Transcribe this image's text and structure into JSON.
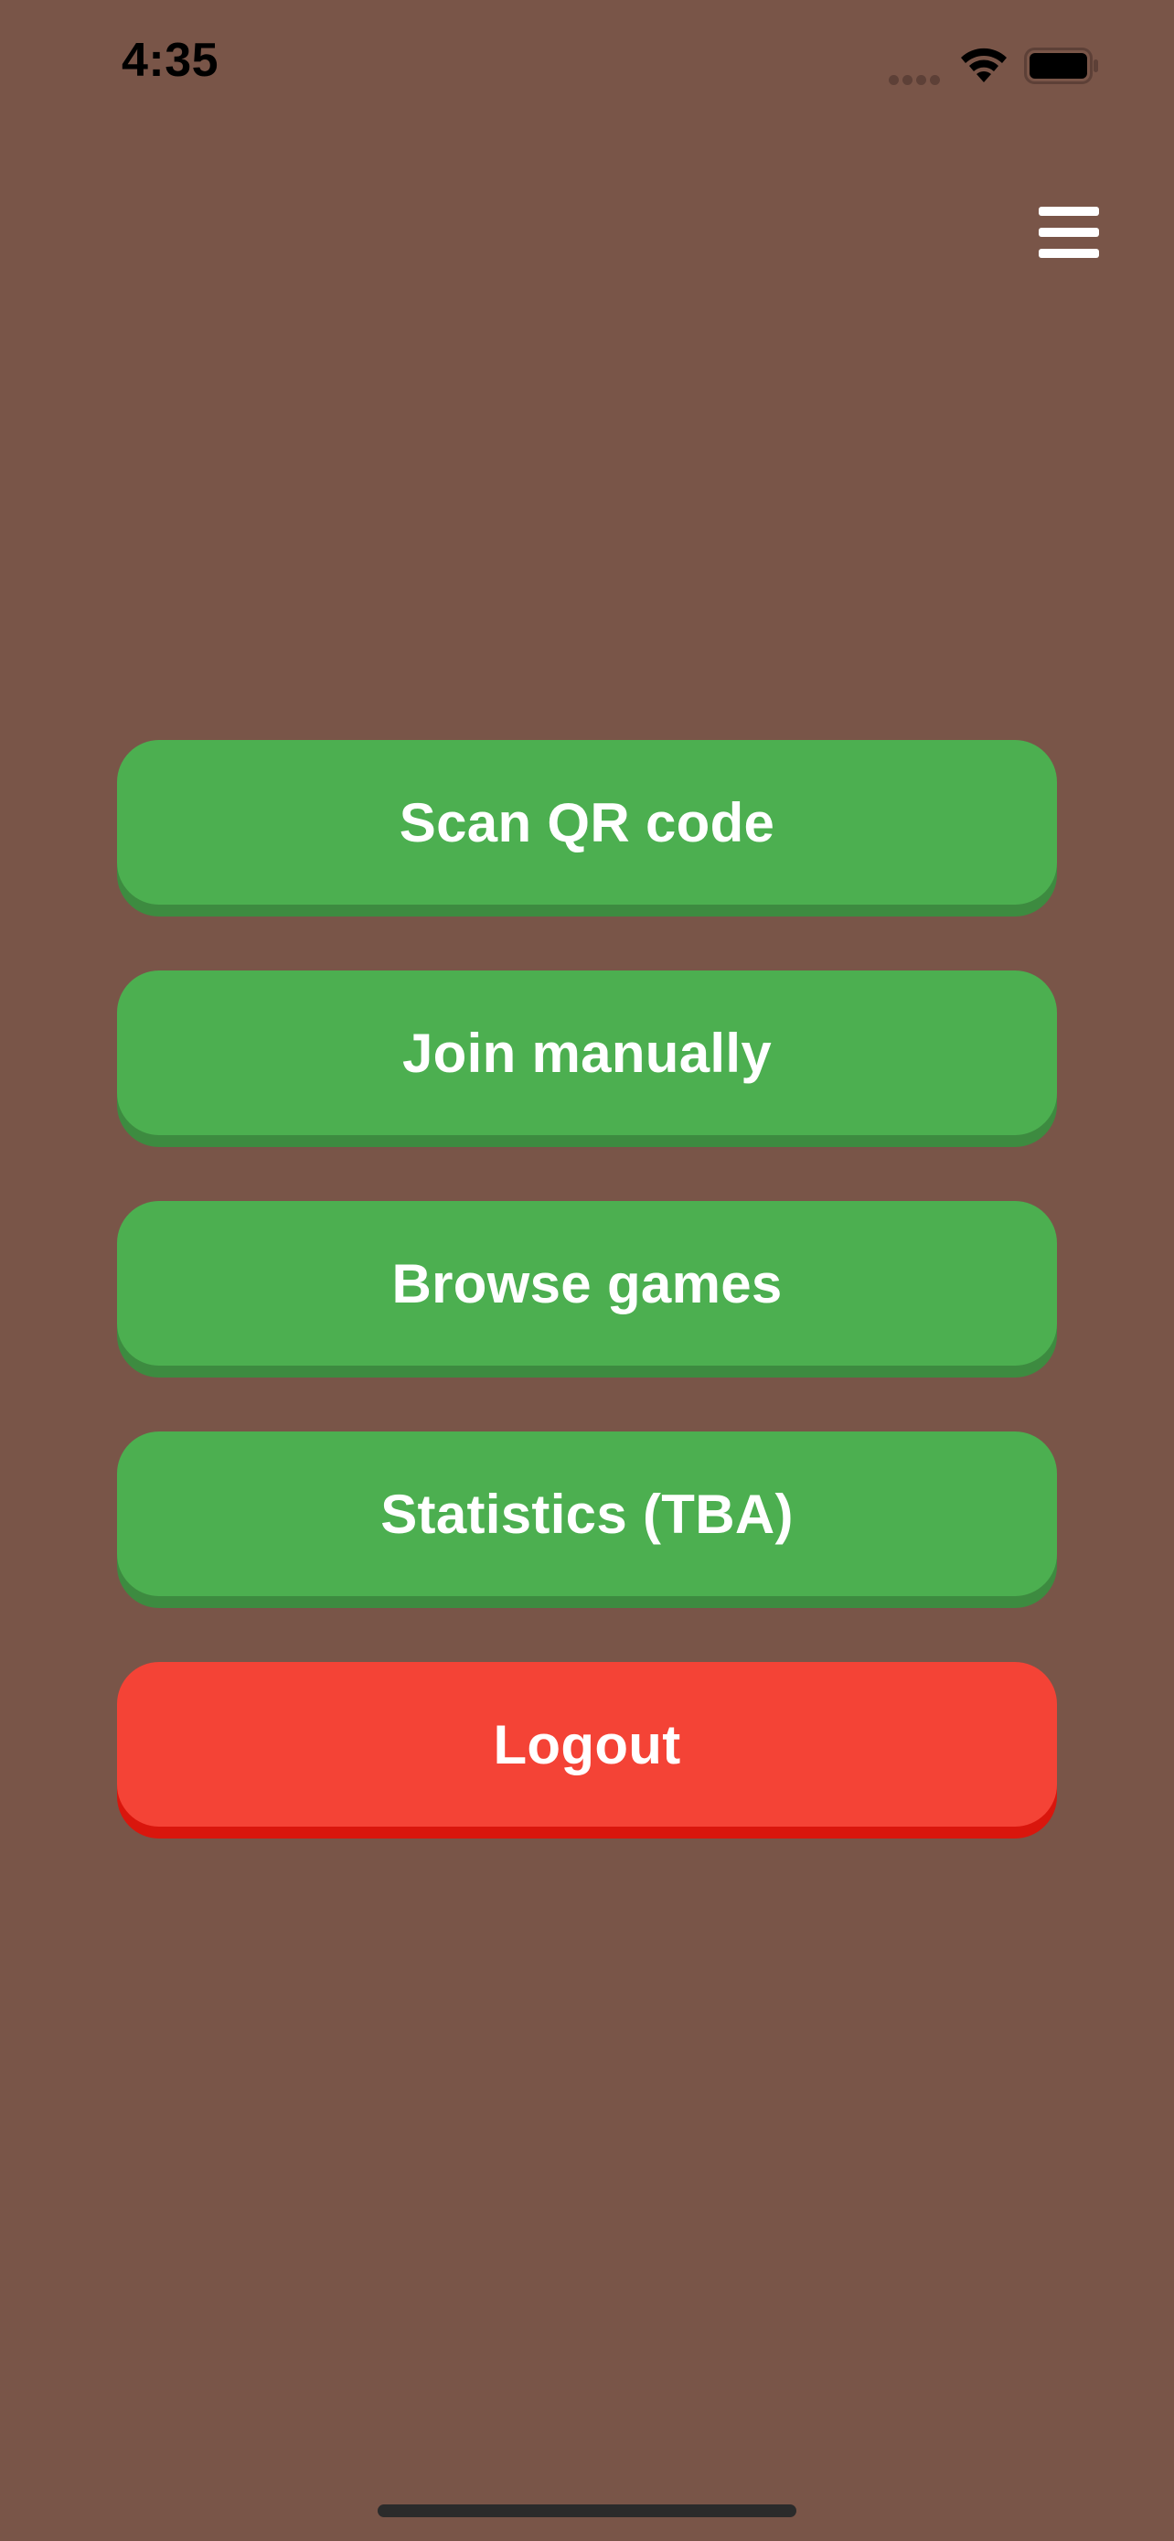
{
  "status_bar": {
    "time": "4:35"
  },
  "header": {
    "menu_icon": "hamburger-menu-icon"
  },
  "buttons": {
    "scan_qr": "Scan QR code",
    "join_manually": "Join manually",
    "browse_games": "Browse games",
    "statistics": "Statistics (TBA)",
    "logout": "Logout"
  },
  "colors": {
    "background": "#795548",
    "primary_button": "#4caf50",
    "primary_button_shadow": "#3d8b40",
    "danger_button": "#f44336",
    "danger_button_shadow": "#d9160d"
  }
}
